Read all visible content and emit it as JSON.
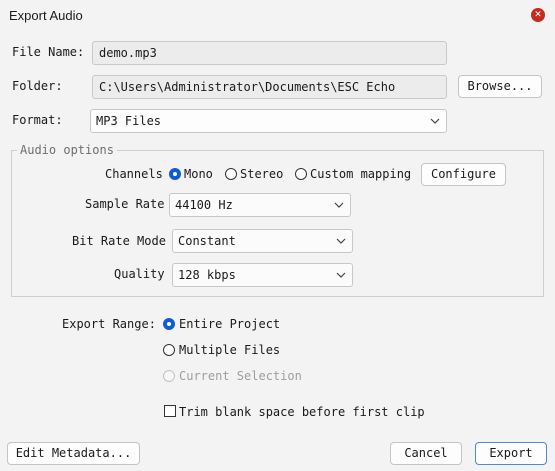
{
  "window": {
    "title": "Export Audio"
  },
  "file_name": {
    "label": "File Name:",
    "value": "demo.mp3"
  },
  "folder": {
    "label": "Folder:",
    "value": "C:\\Users\\Administrator\\Documents\\ESC Echo",
    "browse_label": "Browse..."
  },
  "format": {
    "label": "Format:",
    "value": "MP3 Files"
  },
  "audio_options": {
    "title": "Audio options",
    "channels": {
      "label": "Channels",
      "options": [
        "Mono",
        "Stereo",
        "Custom mapping"
      ],
      "selected": "Mono",
      "configure_label": "Configure"
    },
    "sample_rate": {
      "label": "Sample Rate",
      "value": "44100 Hz"
    },
    "bit_rate_mode": {
      "label": "Bit Rate Mode",
      "value": "Constant"
    },
    "quality": {
      "label": "Quality",
      "value": "128 kbps"
    }
  },
  "export_range": {
    "label": "Export Range:",
    "options": [
      "Entire Project",
      "Multiple Files",
      "Current Selection"
    ],
    "selected": "Entire Project",
    "disabled": [
      "Current Selection"
    ]
  },
  "trim": {
    "label": "Trim blank space before first clip",
    "checked": false
  },
  "footer": {
    "edit_metadata_label": "Edit Metadata...",
    "cancel_label": "Cancel",
    "export_label": "Export"
  },
  "colors": {
    "accent": "#0f5bd6",
    "close": "#c42b1c",
    "background": "#f3f3f3"
  }
}
